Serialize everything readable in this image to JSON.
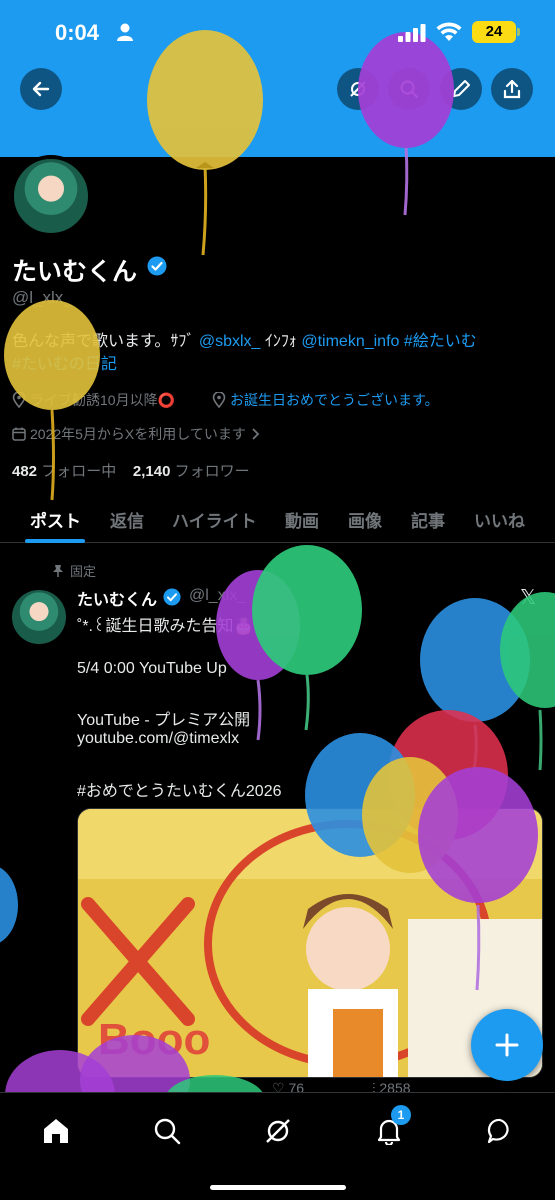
{
  "status_bar": {
    "time": "0:04",
    "battery": "24"
  },
  "header": {
    "icons": [
      "back-arrow-icon",
      "grok-icon",
      "search-icon",
      "edit-icon",
      "share-icon"
    ]
  },
  "profile": {
    "name": "たいむくん",
    "handle": "@l_xlx_",
    "bio_parts": {
      "text1": "色んな声で歌います。ｻﾌﾞ ",
      "link1": "@sbxlx_",
      "text2": " ｲﾝﾌｫ ",
      "link2": "@timekn_info",
      "text3": " ",
      "tag1": "#絵たいむ",
      "tag2": "#たいむの日記"
    },
    "location": "ライブ勧誘10月以降⭕️",
    "birthday": "お誕生日おめでとうございます。",
    "joined": "2022年5月からXを利用しています",
    "following_count": "482",
    "following_label": "フォロー中",
    "followers_count": "2,140",
    "followers_label": "フォロワー"
  },
  "tabs": [
    "ポスト",
    "返信",
    "ハイライト",
    "動画",
    "画像",
    "記事",
    "いいね"
  ],
  "post": {
    "pinned_label": "固定",
    "name": "たいむくん",
    "handle": "@l_xlx_",
    "line1": "˚*.꒰誕生日歌みた告知🎂",
    "line2": "5/4 0:00 YouTube Up",
    "line3": "YouTube - プレミア公開",
    "line4": "youtube.com/@timexlx",
    "line5": "#おめでとうたいむくん2026",
    "likes": "76",
    "views": "2858"
  },
  "bottom_nav": {
    "notification_count": "1"
  },
  "colors": {
    "accent": "#1d9bf0",
    "background": "#000000",
    "banner": "#1d9bf0"
  }
}
